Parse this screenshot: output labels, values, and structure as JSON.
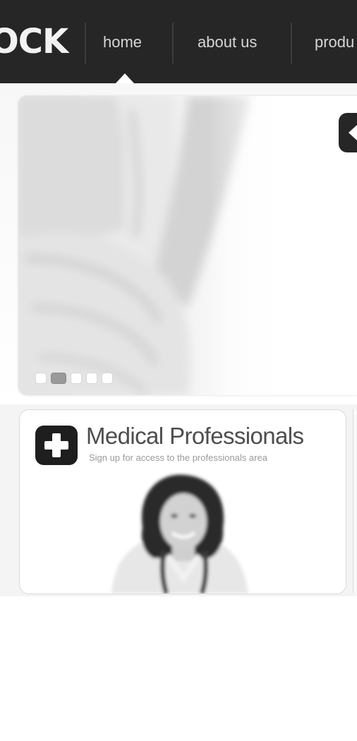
{
  "nav": {
    "logo": "OCK",
    "items": [
      {
        "label": "home",
        "active": true
      },
      {
        "label": "about us",
        "active": false
      },
      {
        "label": "produ",
        "active": false
      }
    ]
  },
  "hero": {
    "slides_total": 5,
    "active_slide": 2
  },
  "card": {
    "title": "Medical Professionals",
    "subtitle": "Sign up for access to the professionals area",
    "icon": "medical-plus-icon"
  },
  "colors": {
    "nav_bg": "#262626",
    "nav_text": "#d6d6d6",
    "title": "#4d4d4d",
    "icon_bg": "#1e1e1e"
  }
}
